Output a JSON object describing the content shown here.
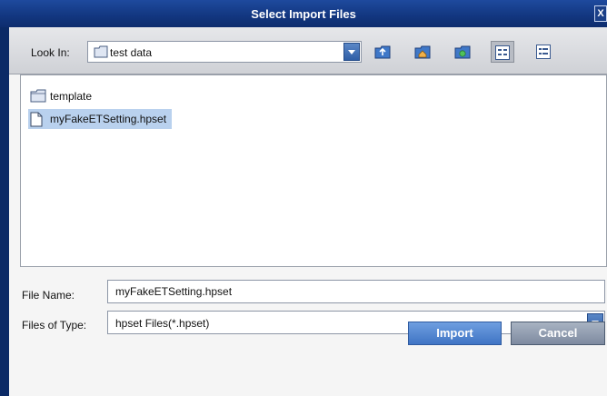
{
  "window": {
    "title": "Select Import Files",
    "close_glyph": "X"
  },
  "toolbar": {
    "look_in_label": "Look In:",
    "look_in_value": "test data",
    "buttons": [
      {
        "name": "up-folder-icon"
      },
      {
        "name": "home-icon"
      },
      {
        "name": "new-folder-icon"
      },
      {
        "name": "list-view-icon",
        "selected": true
      },
      {
        "name": "details-view-icon",
        "selected": false
      }
    ]
  },
  "files": [
    {
      "name": "template",
      "type": "folder",
      "icon": "folder-icon",
      "selected": false
    },
    {
      "name": "myFakeETSetting.hpset",
      "type": "file",
      "icon": "file-icon",
      "selected": true
    }
  ],
  "form": {
    "file_name_label": "File Name:",
    "file_name_value": "myFakeETSetting.hpset",
    "file_type_label": "Files of Type:",
    "file_type_value": "hpset Files(*.hpset)"
  },
  "buttons": {
    "import": "Import",
    "cancel": "Cancel"
  },
  "colors": {
    "title_bar": "#12367f",
    "selection": "#b9d1ee",
    "import_button": "#3f74c4",
    "cancel_button": "#7e8aa0"
  }
}
